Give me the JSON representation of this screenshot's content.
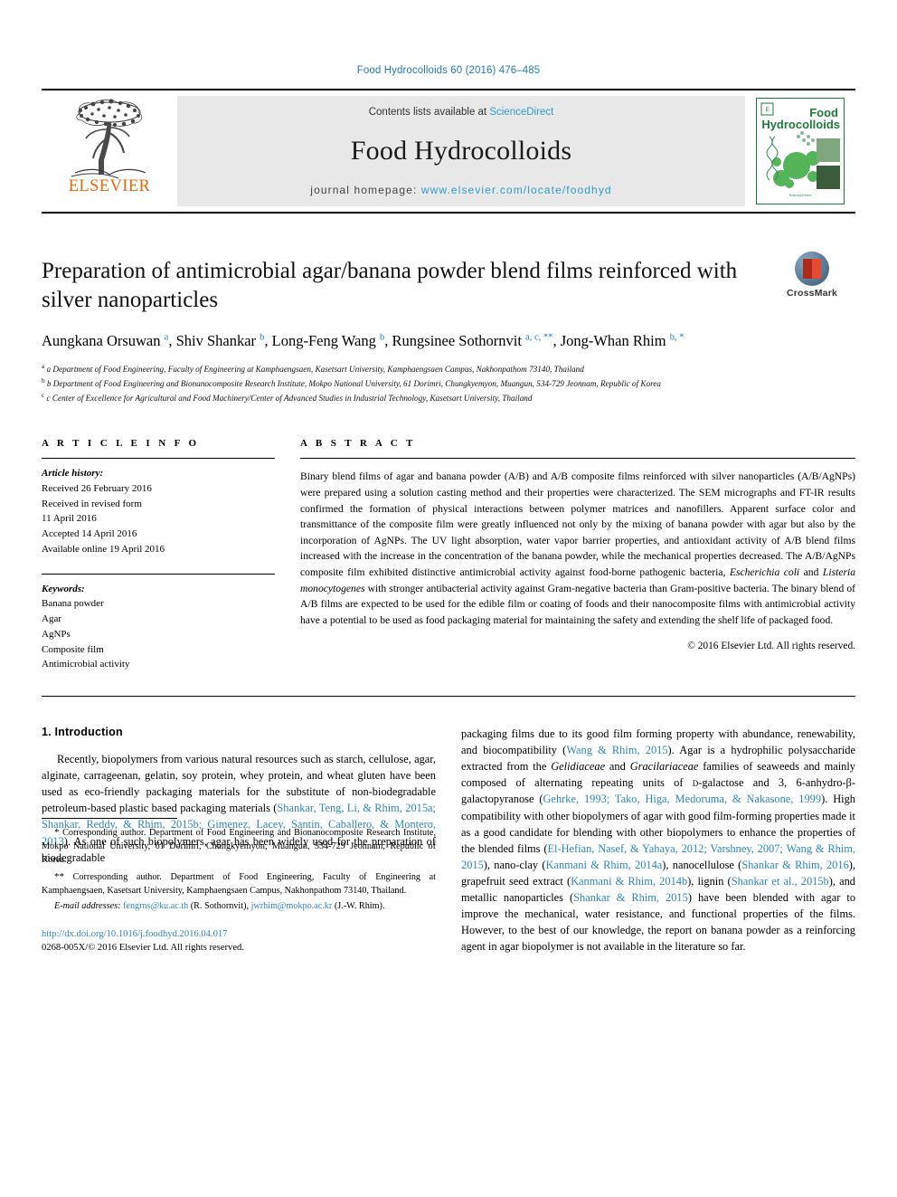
{
  "running_head": "Food Hydrocolloids 60 (2016) 476–485",
  "masthead": {
    "contents_prefix": "Contents lists available at ",
    "sciencedirect": "ScienceDirect",
    "journal_title": "Food Hydrocolloids",
    "homepage_label": "journal homepage: ",
    "homepage_url": "www.elsevier.com/locate/foodhyd",
    "publisher": "ELSEVIER",
    "cover_title_line1": "Food",
    "cover_title_line2": "Hydrocolloids",
    "link_color": "#2f9ccc"
  },
  "article": {
    "title": "Preparation of antimicrobial agar/banana powder blend films reinforced with silver nanoparticles",
    "crossmark_label": "CrossMark",
    "authors_html": "Aungkana Orsuwan <sup>a</sup>, Shiv Shankar <sup>b</sup>, Long-Feng Wang <sup>b</sup>, Rungsinee Sothornvit <sup>a, c, **</sup>, Jong-Whan Rhim <sup>b, *</sup>",
    "affiliations": [
      "a Department of Food Engineering, Faculty of Engineering at Kamphaengsaen, Kasetsart University, Kamphaengsaen Campus, Nakhonpathom 73140, Thailand",
      "b Department of Food Engineering and Bionanocomposite Research Institute, Mokpo National University, 61 Dorimri, Chungkyemyon, Muangun, 534-729 Jeonnam, Republic of Korea",
      "c Center of Excellence for Agricultural and Food Machinery/Center of Advanced Studies in Industrial Technology, Kasetsart University, Thailand"
    ]
  },
  "article_info": {
    "heading": "A R T I C L E  I N F O",
    "history_label": "Article history:",
    "history": [
      "Received 26 February 2016",
      "Received in revised form",
      "11 April 2016",
      "Accepted 14 April 2016",
      "Available online 19 April 2016"
    ],
    "keywords_label": "Keywords:",
    "keywords": [
      "Banana powder",
      "Agar",
      "AgNPs",
      "Composite film",
      "Antimicrobial activity"
    ]
  },
  "abstract": {
    "heading": "A B S T R A C T",
    "body_html": "Binary blend films of agar and banana powder (A/B) and A/B composite films reinforced with silver nanoparticles (A/B/AgNPs) were prepared using a solution casting method and their properties were characterized. The SEM micrographs and FT-IR results confirmed the formation of physical interactions between polymer matrices and nanofillers. Apparent surface color and transmittance of the composite film were greatly influenced not only by the mixing of banana powder with agar but also by the incorporation of AgNPs. The UV light absorption, water vapor barrier properties, and antioxidant activity of A/B blend films increased with the increase in the concentration of the banana powder, while the mechanical properties decreased. The A/B/AgNPs composite film exhibited distinctive antimicrobial activity against food-borne pathogenic bacteria, <i>Escherichia coli</i> and <i>Listeria monocytogenes</i> with stronger antibacterial activity against Gram-negative bacteria than Gram-positive bacteria. The binary blend of A/B films are expected to be used for the edible film or coating of foods and their nanocomposite films with antimicrobial activity have a potential to be used as food packaging material for maintaining the safety and extending the shelf life of packaged food.",
    "copyright": "© 2016 Elsevier Ltd. All rights reserved."
  },
  "introduction": {
    "heading": "1. Introduction",
    "left_paragraph_html": "Recently, biopolymers from various natural resources such as starch, cellulose, agar, alginate, carrageenan, gelatin, soy protein, whey protein, and wheat gluten have been used as eco-friendly packaging materials for the substitute of non-biodegradable petroleum-based plastic based packaging materials (<span class=\"cite\">Shankar, Teng, Li, &amp; Rhim, 2015a; Shankar, Reddy, &amp; Rhim, 2015b; Gimenez, Lacey, Santin, Caballero, &amp; Montero, 2013</span>). As one of such biopolymers, agar has been widely used for the preparation of biodegradable",
    "right_paragraph_html": "packaging films due to its good film forming property with abundance, renewability, and biocompatibility (<span class=\"cite\">Wang &amp; Rhim, 2015</span>). Agar is a hydrophilic polysaccharide extracted from the <i>Gelidiaceae</i> and <i>Gracilariaceae</i> families of seaweeds and mainly composed of alternating repeating units of <span style=\"font-variant:small-caps\">d</span>-galactose and 3, 6-anhydro-β-galactopyranose (<span class=\"cite\">Gehrke, 1993; Tako, Higa, Medoruma, &amp; Nakasone, 1999</span>). High compatibility with other biopolymers of agar with good film-forming properties made it as a good candidate for blending with other biopolymers to enhance the properties of the blended films (<span class=\"cite\">El-Hefian, Nasef, &amp; Yahaya, 2012; Varshney, 2007; Wang &amp; Rhim, 2015</span>), nano-clay (<span class=\"cite\">Kanmani &amp; Rhim, 2014a</span>), nanocellulose (<span class=\"cite\">Shankar &amp; Rhim, 2016</span>), grapefruit seed extract (<span class=\"cite\">Kanmani &amp; Rhim, 2014b</span>), lignin (<span class=\"cite\">Shankar et al., 2015b</span>), and metallic nanoparticles (<span class=\"cite\">Shankar &amp; Rhim, 2015</span>) have been blended with agar to improve the mechanical, water resistance, and functional properties of the films. However, to the best of our knowledge, the report on banana powder as a reinforcing agent in agar biopolymer is not available in the literature so far."
  },
  "footnotes": {
    "note1_html": "<span class=\"mark\">*</span> Corresponding author. Department of Food Engineering and Bionanocomposite Research Institute, Mokpo National University, 61 Dorimri, Chungkyemyon, Muangun, 534-729 Jeonnam, Republic of Korea.",
    "note2_html": "<span class=\"mark\">**</span> Corresponding author. Department of Food Engineering, Faculty of Engineering at Kamphaengsaen, Kasetsart University, Kamphaengsaen Campus, Nakhonpathom 73140, Thailand.",
    "email_html": "<span class=\"em\">E-mail addresses:</span> <span class=\"cite\">fengrns@ku.ac.th</span> (R. Sothornvit), <span class=\"cite\">jwrhim@mokpo.ac.kr</span> (J.-W. Rhim).",
    "doi_html": "<span class=\"link\">http://dx.doi.org/10.1016/j.foodhyd.2016.04.017</span>",
    "issn_html": "0268-005X/© 2016 Elsevier Ltd. All rights reserved."
  }
}
